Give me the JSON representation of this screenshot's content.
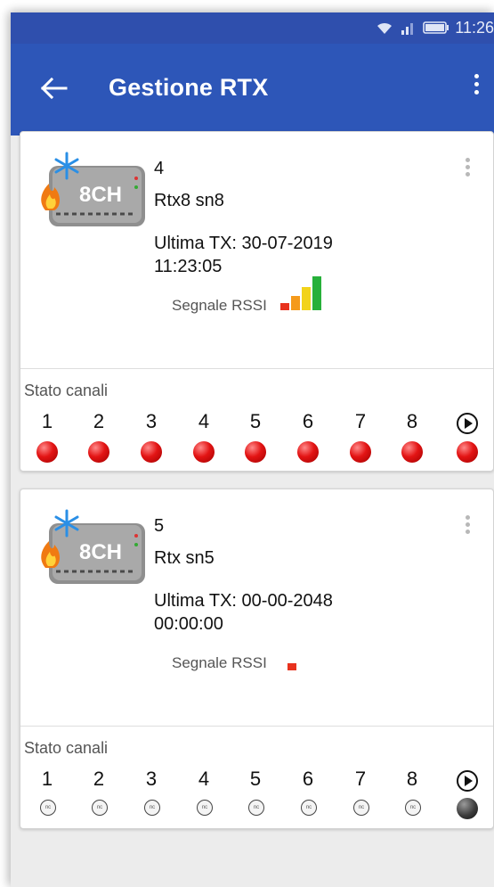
{
  "status_bar": {
    "time": "11:26"
  },
  "app_bar": {
    "title": "Gestione RTX"
  },
  "device_badge": "8CH",
  "rssi_label": "Segnale RSSI",
  "channels_label": "Stato canali",
  "channel_numbers": [
    "1",
    "2",
    "3",
    "4",
    "5",
    "6",
    "7",
    "8"
  ],
  "cards": [
    {
      "id": "4",
      "name": "Rtx8 sn8",
      "last_tx_label": "Ultima TX: 30-07-2019",
      "last_tx_time": "11:23:05",
      "rssi_level": 4,
      "channel_states": [
        "red",
        "red",
        "red",
        "red",
        "red",
        "red",
        "red",
        "red"
      ],
      "extra_led": "red"
    },
    {
      "id": "5",
      "name": "Rtx sn5",
      "last_tx_label": "Ultima TX: 00-00-2048",
      "last_tx_time": "00:00:00",
      "rssi_level": 1,
      "channel_states": [
        "nc",
        "nc",
        "nc",
        "nc",
        "nc",
        "nc",
        "nc",
        "nc"
      ],
      "extra_led": "dark"
    }
  ],
  "led_off_text": "nc",
  "colors": {
    "status_bar": "#2f4fad",
    "app_bar": "#2d56b8",
    "rssi_red": "#e8321e",
    "rssi_orange": "#f59a1b",
    "rssi_yellow": "#f2d31a",
    "rssi_green": "#27b03a"
  }
}
